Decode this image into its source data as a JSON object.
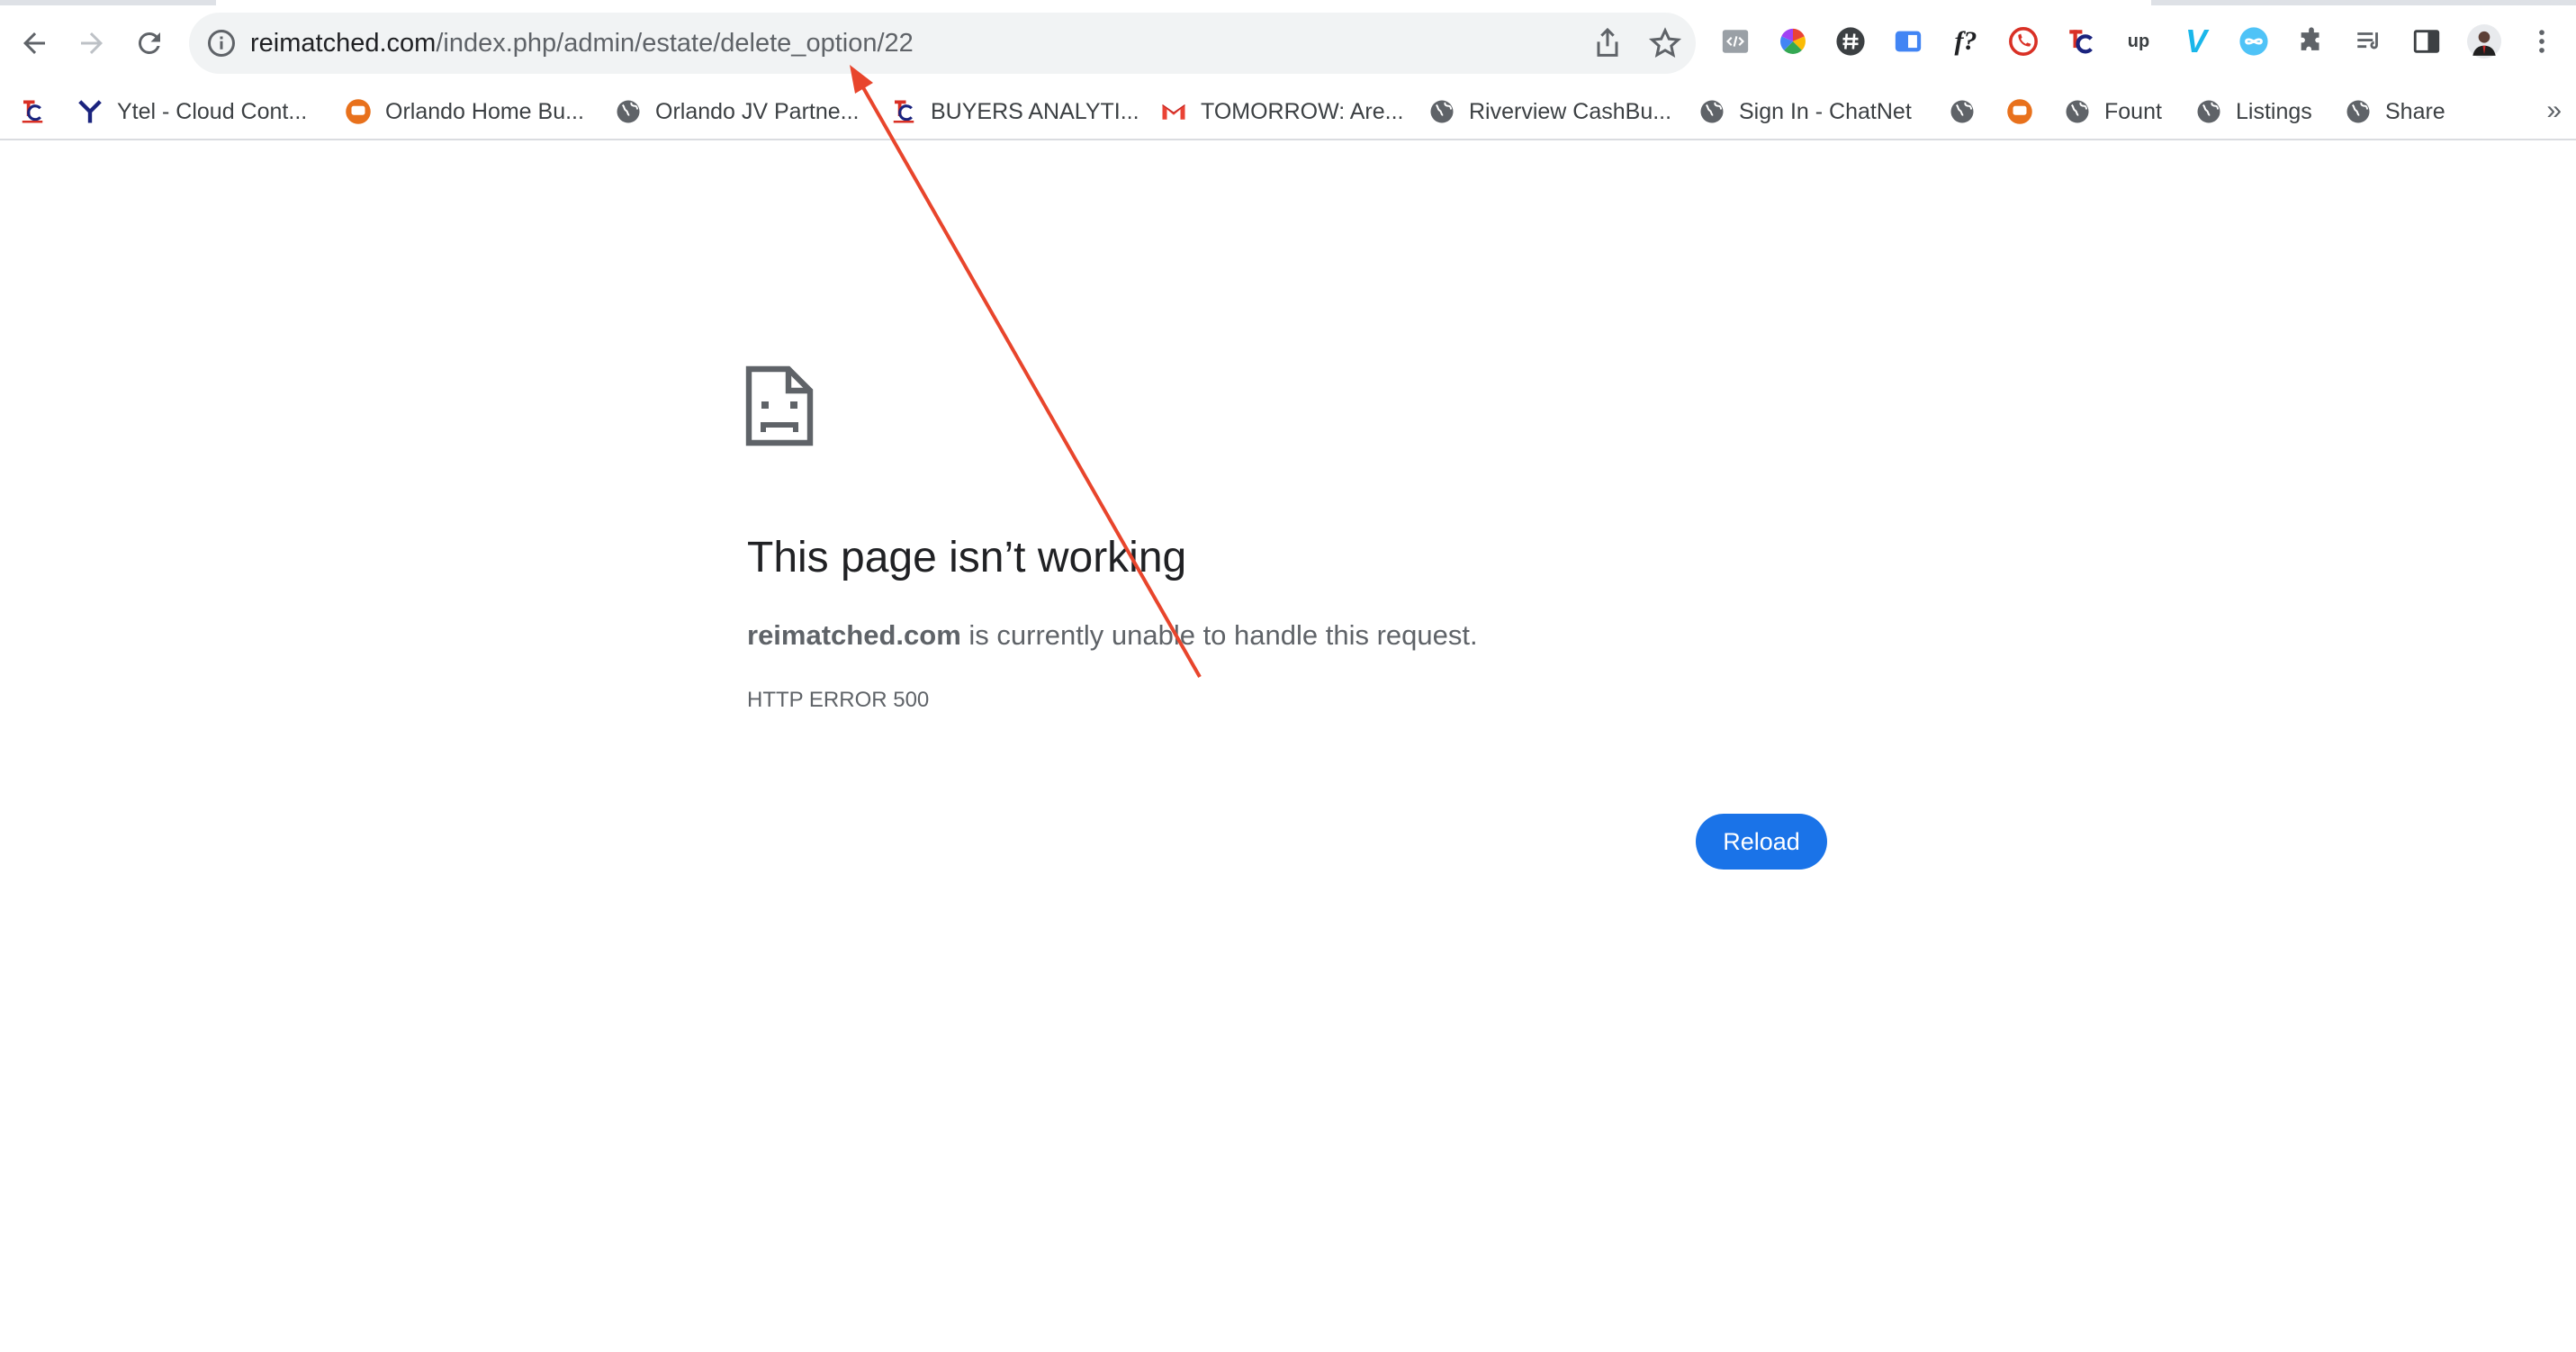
{
  "omnibox": {
    "url_host": "reimatched.com",
    "url_path": "/index.php/admin/estate/delete_option/22"
  },
  "extensions": {
    "f_label": "f?",
    "up_label": "up",
    "v_label": "V"
  },
  "bookmarks": {
    "items": [
      {
        "label": ""
      },
      {
        "label": "Ytel - Cloud Cont..."
      },
      {
        "label": "Orlando Home Bu..."
      },
      {
        "label": "Orlando JV Partne..."
      },
      {
        "label": "BUYERS ANALYTI..."
      },
      {
        "label": "TOMORROW: Are..."
      },
      {
        "label": "Riverview CashBu..."
      },
      {
        "label": "Sign In - ChatNet"
      },
      {
        "label": ""
      },
      {
        "label": ""
      },
      {
        "label": "Fount"
      },
      {
        "label": "Listings"
      },
      {
        "label": "Share"
      }
    ],
    "more": "»"
  },
  "error": {
    "title": "This page isn’t working",
    "host": "reimatched.com",
    "message": " is currently unable to handle this request.",
    "code": "HTTP ERROR 500",
    "reload_label": "Reload"
  },
  "colors": {
    "accent": "#1a73e8",
    "annotation": "#e8452c"
  }
}
